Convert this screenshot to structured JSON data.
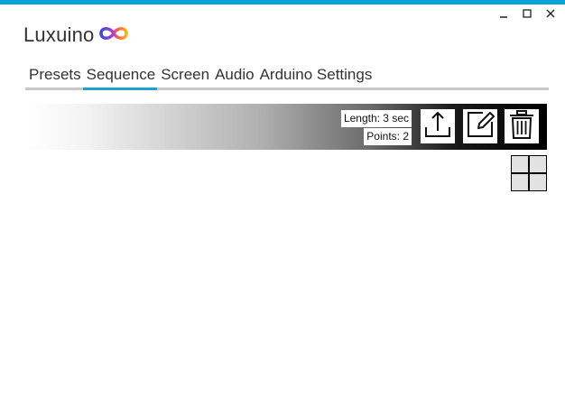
{
  "app": {
    "title": "Luxuino"
  },
  "window": {
    "minimize_icon": "minimize-icon",
    "maximize_icon": "maximize-icon",
    "close_icon": "close-icon"
  },
  "tabs": [
    {
      "label": "Presets",
      "active": false
    },
    {
      "label": "Sequence",
      "active": true
    },
    {
      "label": "Screen",
      "active": false
    },
    {
      "label": "Audio",
      "active": false
    },
    {
      "label": "Arduino Settings",
      "active": false
    }
  ],
  "sequence": {
    "length_text": "Length: 3 sec",
    "points_text": "Points: 2",
    "buttons": {
      "upload_icon": "upload-icon",
      "edit_icon": "edit-icon",
      "delete_icon": "trash-icon"
    },
    "add_tile_icon": "add-sequence-icon"
  },
  "colors": {
    "accent": "#0aa3d6",
    "tab_underline": "#1aa3cf",
    "logo_gradient": [
      "#3b4bd8",
      "#b03ad0",
      "#ff6a3d",
      "#ffb31a"
    ]
  }
}
